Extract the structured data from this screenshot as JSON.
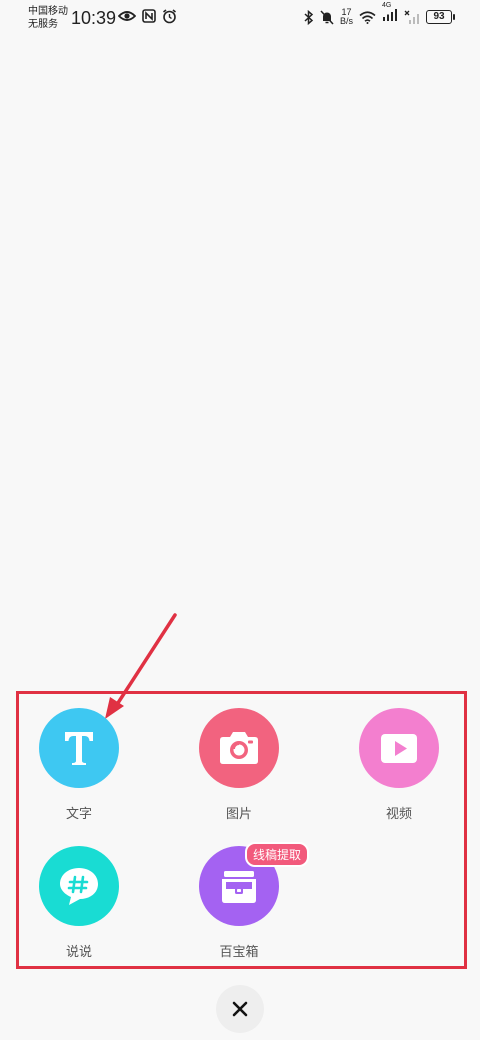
{
  "status_bar": {
    "carrier_line1": "中国移动",
    "carrier_line2": "无服务",
    "time": "10:39",
    "speed_value": "17",
    "speed_unit": "B/s",
    "network_label": "4G",
    "battery": "93"
  },
  "menu": {
    "items": [
      {
        "label": "文字",
        "icon": "text-icon",
        "color": "#3ec8f2"
      },
      {
        "label": "图片",
        "icon": "camera-icon",
        "color": "#f2637f"
      },
      {
        "label": "视频",
        "icon": "video-icon",
        "color": "#f37fcf"
      },
      {
        "label": "说说",
        "icon": "hashtag-speech-icon",
        "color": "#19dcd3"
      },
      {
        "label": "百宝箱",
        "icon": "treasure-box-icon",
        "color": "#a462f2",
        "badge": "线稿提取"
      }
    ]
  },
  "close_button": {
    "icon": "close-icon"
  },
  "annotation": {
    "color": "#e03143"
  }
}
